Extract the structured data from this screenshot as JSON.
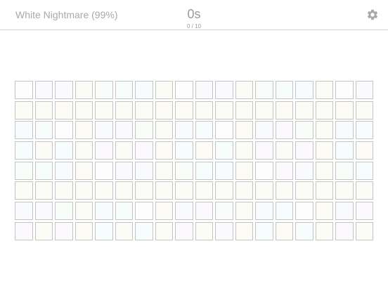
{
  "header": {
    "level_title": "White Nightmare (99%)",
    "timer": "0s",
    "progress": "0 / 10",
    "settings_icon": "gear-icon"
  },
  "board": {
    "rows": 8,
    "columns": 18,
    "palette": [
      "#fdfdfd",
      "#fcfcf7",
      "#f8fbfd",
      "#fbf9fd",
      "#f8fdf9",
      "#fdfbf6",
      "#f9fafe",
      "#f7fcfc"
    ],
    "colors": {
      "gear": "#a8a8a8",
      "tile_border": "#c4c4c4",
      "divider": "#d4d4d4"
    }
  }
}
